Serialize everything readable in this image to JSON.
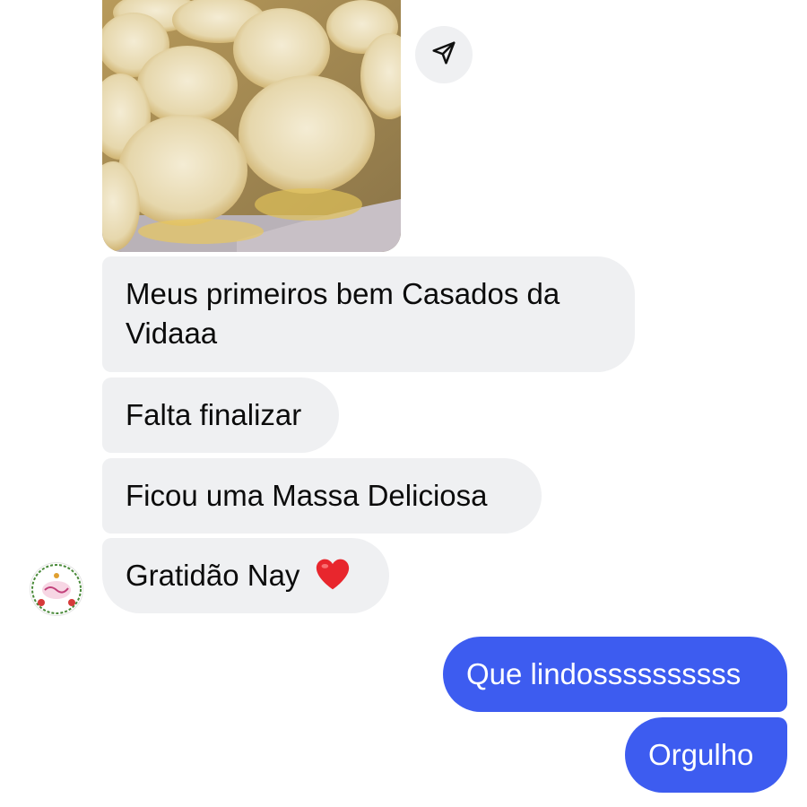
{
  "messages": {
    "incoming": [
      "Meus primeiros bem Casados da Vidaaa",
      "Falta finalizar",
      "Ficou uma Massa Deliciosa",
      "Gratidão Nay"
    ],
    "outgoing": [
      "Que lindossssssssss",
      "Orgulho"
    ],
    "reaction_emoji": "heart-icon"
  },
  "colors": {
    "incoming_bubble": "#eff0f2",
    "outgoing_bubble": "#3d5cf0",
    "incoming_text": "#0b0b0b",
    "outgoing_text": "#ffffff"
  },
  "photo": {
    "subject": "photo of coconut cakes on a gold tray"
  },
  "icons": {
    "share": "paper-plane-icon",
    "avatar": "contact-avatar-icon"
  }
}
